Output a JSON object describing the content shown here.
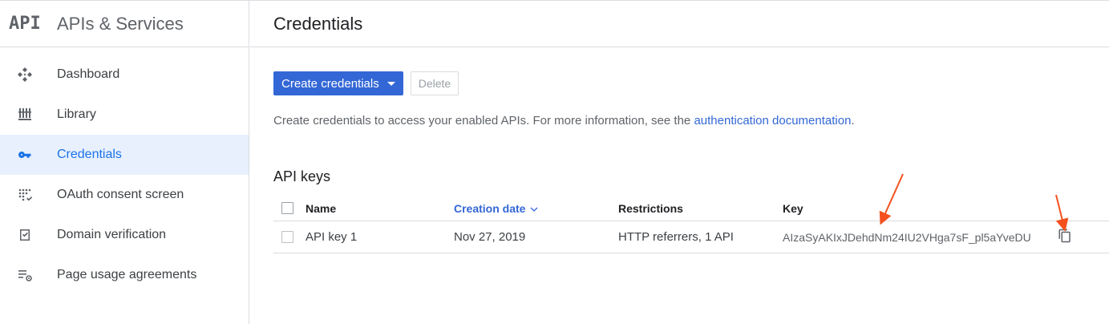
{
  "sidebar": {
    "logo": "API",
    "title": "APIs & Services",
    "items": [
      {
        "label": "Dashboard",
        "icon": "dashboard-icon",
        "active": false
      },
      {
        "label": "Library",
        "icon": "library-icon",
        "active": false
      },
      {
        "label": "Credentials",
        "icon": "key-icon",
        "active": true
      },
      {
        "label": "OAuth consent screen",
        "icon": "oauth-icon",
        "active": false
      },
      {
        "label": "Domain verification",
        "icon": "domain-check-icon",
        "active": false
      },
      {
        "label": "Page usage agreements",
        "icon": "settings-list-icon",
        "active": false
      }
    ]
  },
  "main": {
    "title": "Credentials",
    "toolbar": {
      "create_label": "Create credentials",
      "delete_label": "Delete"
    },
    "info": {
      "text": "Create credentials to access your enabled APIs. For more information, see the ",
      "link": "authentication documentation",
      "suffix": "."
    },
    "section_title": "API keys",
    "table": {
      "headers": {
        "name": "Name",
        "creation_date": "Creation date",
        "restrictions": "Restrictions",
        "key": "Key"
      },
      "rows": [
        {
          "name": "API key 1",
          "creation_date": "Nov 27, 2019",
          "restrictions": "HTTP referrers, 1 API",
          "key": "AIzaSyAKIxJDehdNm24IU2VHga7sF_pl5aYveDU"
        }
      ]
    }
  },
  "colors": {
    "accent": "#3367d6",
    "active_bg": "#e8f0fe",
    "annotation_arrow": "#f4511e"
  }
}
